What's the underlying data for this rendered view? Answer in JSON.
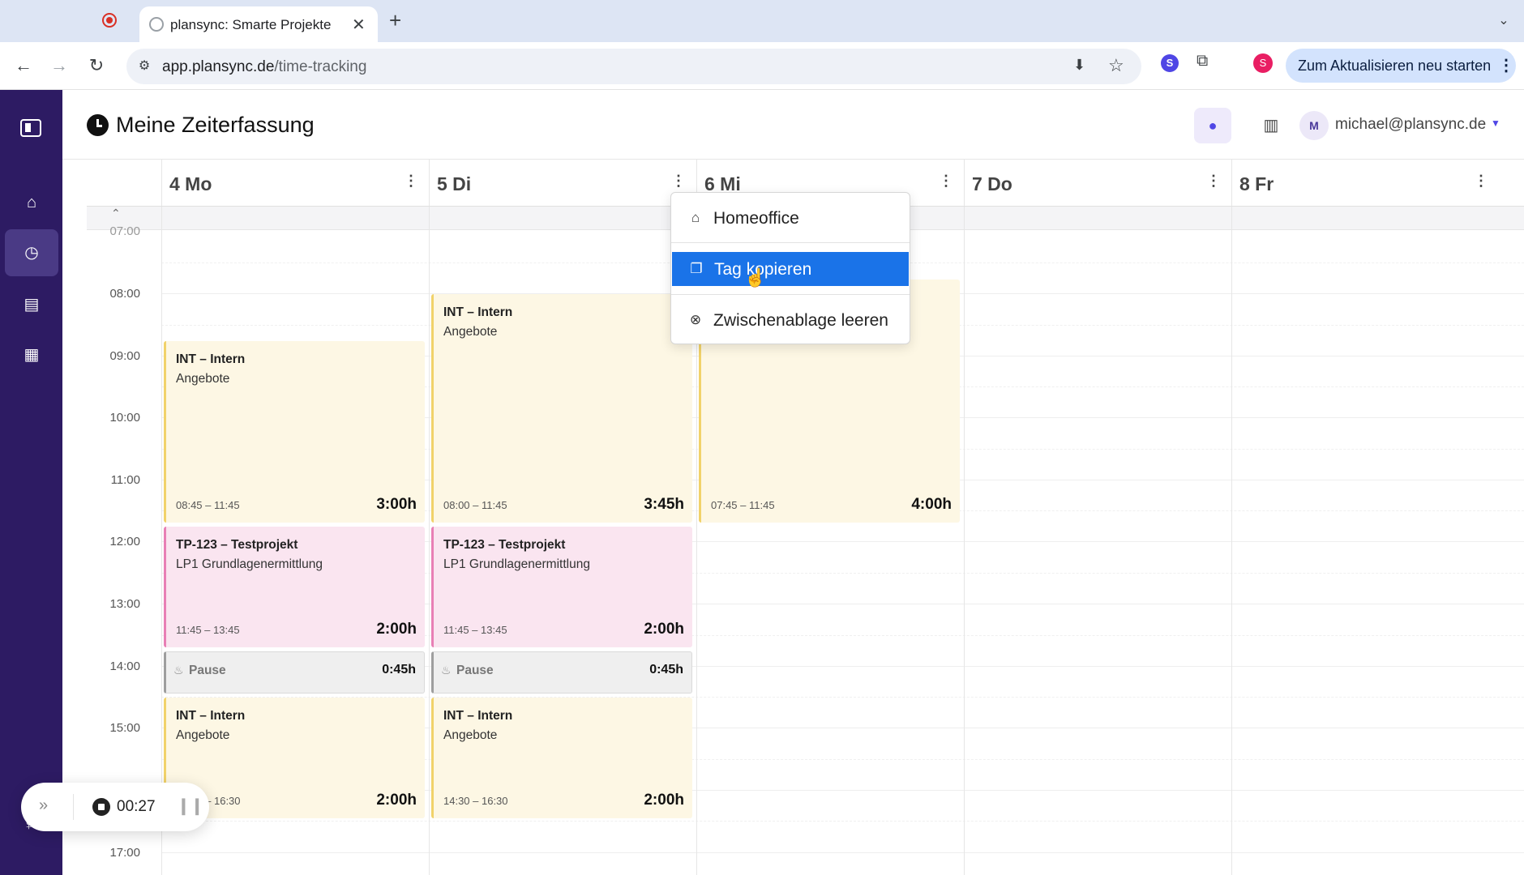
{
  "browser": {
    "tab_title": "plansync: Smarte Projekte",
    "tab_close": "✕",
    "new_tab": "+",
    "url_host": "app.plansync.de",
    "url_path": "/time-tracking",
    "update_button": "Zum Aktualisieren neu starten",
    "extension_badge": "S",
    "profile_initial": "S"
  },
  "header": {
    "title": "Meine Zeiterfassung",
    "avatar_initial": "M",
    "user_email": "michael@plansync.de"
  },
  "calendar": {
    "days": [
      {
        "label": "4 Mo"
      },
      {
        "label": "5 Di"
      },
      {
        "label": "6 Mi"
      },
      {
        "label": "7 Do"
      },
      {
        "label": "8 Fr"
      }
    ],
    "hours": [
      "07:00",
      "08:00",
      "09:00",
      "10:00",
      "11:00",
      "12:00",
      "13:00",
      "14:00",
      "15:00",
      "16:00",
      "17:00"
    ],
    "events": {
      "mo_1": {
        "title": "INT – Intern",
        "subtitle": "Angebote",
        "time": "08:45 – 11:45",
        "duration": "3:00h"
      },
      "mo_2": {
        "title": "TP-123 – Testprojekt",
        "subtitle": "LP1 Grundlagenermittlung",
        "time": "11:45 – 13:45",
        "duration": "2:00h"
      },
      "mo_pause": {
        "title": "Pause",
        "duration": "0:45h"
      },
      "mo_3": {
        "title": "INT – Intern",
        "subtitle": "Angebote",
        "time": "14:30 – 16:30",
        "duration": "2:00h"
      },
      "di_1": {
        "title": "INT – Intern",
        "subtitle": "Angebote",
        "time": "08:00 – 11:45",
        "duration": "3:45h"
      },
      "di_2": {
        "title": "TP-123 – Testprojekt",
        "subtitle": "LP1 Grundlagenermittlung",
        "time": "11:45 – 13:45",
        "duration": "2:00h"
      },
      "di_pause": {
        "title": "Pause",
        "duration": "0:45h"
      },
      "di_3": {
        "title": "INT – Intern",
        "subtitle": "Angebote",
        "time": "14:30 – 16:30",
        "duration": "2:00h"
      },
      "mi_1": {
        "time": "07:45 – 11:45",
        "duration": "4:00h"
      }
    }
  },
  "context_menu": {
    "items": [
      {
        "label": "Homeoffice",
        "icon": "house-icon"
      },
      {
        "label": "Tag kopieren",
        "icon": "clipboard-icon"
      },
      {
        "label": "Zwischenablage leeren",
        "icon": "circle-x-icon"
      }
    ]
  },
  "timer": {
    "elapsed": "00:27"
  },
  "colors": {
    "sidebar_bg": "#2d1b63",
    "accent": "#4f46e5",
    "menu_selected": "#1a73e8",
    "intern_event": "#fdf7e4",
    "project_event": "#fae5f0"
  }
}
